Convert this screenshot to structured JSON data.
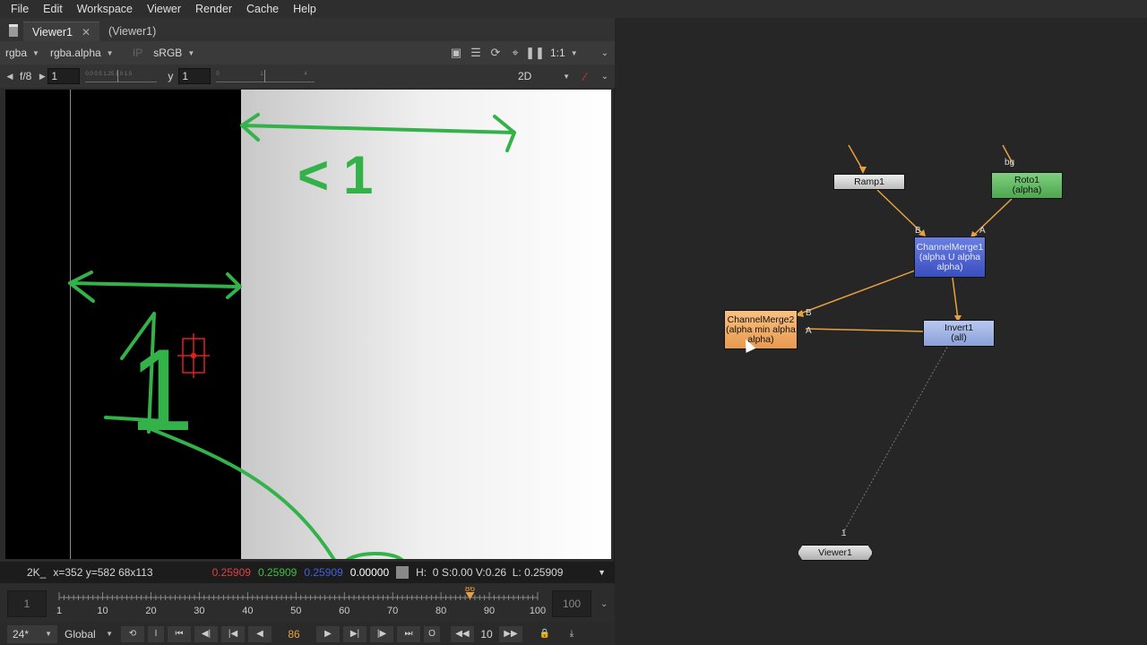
{
  "menu": {
    "items": [
      "File",
      "Edit",
      "Workspace",
      "Viewer",
      "Render",
      "Cache",
      "Help"
    ]
  },
  "tabs": [
    {
      "label": "Viewer1",
      "close": "✕"
    },
    {
      "label": "(Viewer1)"
    }
  ],
  "toolbar1": {
    "channels": "rgba",
    "channel_single": "rgba.alpha",
    "ip": "IP",
    "lut": "sRGB",
    "zoom": "1:1"
  },
  "toolbar2": {
    "fstop": "f/8",
    "gain": "1",
    "gamma_label": "y",
    "gamma": "1",
    "view_mode": "2D",
    "gain_ticks": "0.0 0.5 1.25 1.0 1.5",
    "gamma_ticks": "0 1 4"
  },
  "infobar": {
    "format": "2K_",
    "coords": "x=352 y=582 68x113",
    "r": "0.25909",
    "g": "0.25909",
    "b": "0.25909",
    "a": "0.00000",
    "hsvl": "H:  0 S:0.00 V:0.26  L: 0.25909",
    "r_color": "#e04040",
    "g_color": "#40c040",
    "b_color": "#4060e0"
  },
  "timeline": {
    "start": "1",
    "end": "100",
    "current": "86",
    "ticks": [
      "1",
      "10",
      "20",
      "30",
      "40",
      "50",
      "60",
      "70",
      "80",
      "90",
      "100"
    ]
  },
  "playbar": {
    "fps": "24*",
    "scope": "Global",
    "frame": "86",
    "increment": "10"
  },
  "annotations": {
    "text_lt1": "<1",
    "text_1": "1"
  },
  "nodes": {
    "ramp": {
      "label": "Ramp1"
    },
    "roto": {
      "label": "Roto1",
      "sub": "(alpha)",
      "input": "bg"
    },
    "cm1": {
      "label": "ChannelMerge1",
      "sub": "(alpha U alpha",
      "sub2": "alpha)"
    },
    "cm2": {
      "label": "ChannelMerge2",
      "sub": "(alpha min alpha",
      "sub2": "alpha)"
    },
    "inv": {
      "label": "Invert1",
      "sub": "(all)"
    },
    "viewer": {
      "label": "Viewer1",
      "input": "1"
    },
    "inputs": {
      "b": "B",
      "a": "A"
    }
  },
  "colors": {
    "accent": "#e8a040",
    "annotation": "#33b24a"
  }
}
